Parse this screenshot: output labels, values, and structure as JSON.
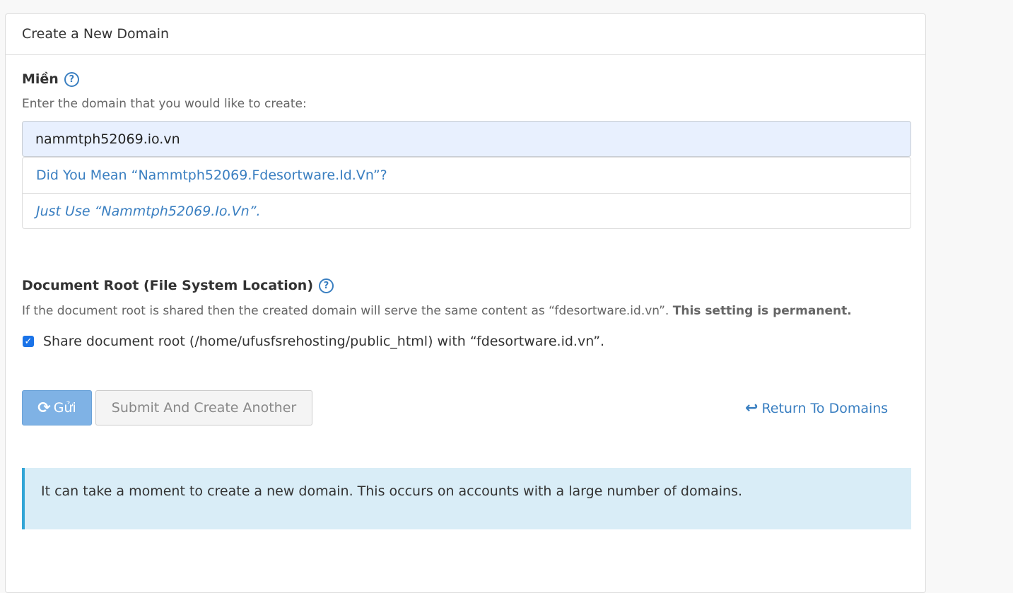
{
  "panel": {
    "title": "Create a New Domain"
  },
  "domain_field": {
    "label": "Miền",
    "help_icon": "question-circle-icon",
    "description": "Enter the domain that you would like to create:",
    "value": "nammtph52069.io.vn",
    "suggestions": [
      "Did You Mean “Nammtph52069.Fdesortware.Id.Vn”?",
      "Just Use “Nammtph52069.Io.Vn”."
    ]
  },
  "document_root": {
    "label": "Document Root (File System Location)",
    "help_icon": "question-circle-icon",
    "description": "If the document root is shared then the created domain will serve the same content as “fdesortware.id.vn”.",
    "description_bold": "This setting is permanent.",
    "checkbox_label": "Share document root (/home/ufusfsrehosting/public_html) with “fdesortware.id.vn”.",
    "checkbox_checked": true
  },
  "actions": {
    "submit_label": "Gửi",
    "submit_icon": "refresh-icon",
    "submit_another_label": "Submit And Create Another",
    "return_label": "Return To Domains",
    "return_icon": "reply-icon"
  },
  "info": {
    "message": "It can take a moment to create a new domain. This occurs on accounts with a large number of domains."
  },
  "colors": {
    "link": "#3a7fc1",
    "primary_button": "#7fb2e5",
    "input_background": "#e8f0fe",
    "info_background": "#d9edf7",
    "info_border": "#31a5d6"
  }
}
